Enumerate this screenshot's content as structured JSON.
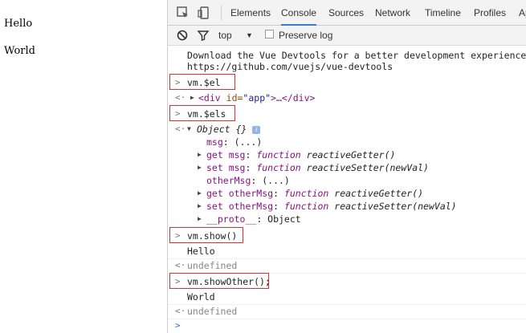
{
  "page": {
    "lines": [
      "Hello",
      "World"
    ]
  },
  "devtools": {
    "tabs": [
      "Elements",
      "Console",
      "Sources",
      "Network",
      "Timeline",
      "Profiles",
      "Ap"
    ],
    "active_tab": "Console",
    "filter": {
      "context": "top",
      "preserve_log": "Preserve log"
    },
    "console": {
      "banner_line1": "Download the Vue Devtools for a better development experience:",
      "banner_line2": "https://github.com/vuejs/vue-devtools",
      "cmd1": "vm.$el",
      "out1_open": "<div",
      "out1_attr": "id=",
      "out1_val": "\"app\"",
      "out1_close": ">…</div>",
      "cmd2": "vm.$els",
      "obj_title": "Object {}",
      "obj_badge": "i",
      "p1_key": "msg",
      "p1_val": ": (...)",
      "p2_key": "get msg",
      "p2_kw": "function",
      "p2_fn": "reactiveGetter()",
      "p3_key": "set msg",
      "p3_kw": "function",
      "p3_fn": "reactiveSetter(newVal)",
      "p4_key": "otherMsg",
      "p4_val": ": (...)",
      "p5_key": "get otherMsg",
      "p5_kw": "function",
      "p5_fn": "reactiveGetter()",
      "p6_key": "set otherMsg",
      "p6_kw": "function",
      "p6_fn": "reactiveSetter(newVal)",
      "p7_key": "__proto__",
      "p7_val": ": Object",
      "cmd3": "vm.show()",
      "log1": "Hello",
      "ret1": "undefined",
      "cmd4": "vm.showOther();",
      "log2": "World",
      "ret2": "undefined"
    }
  }
}
